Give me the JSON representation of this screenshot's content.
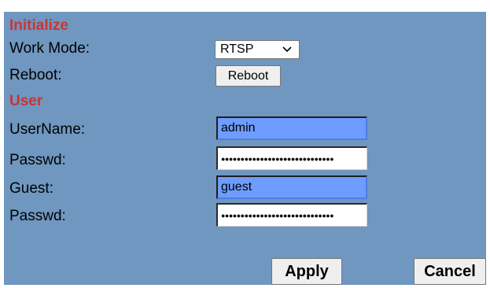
{
  "initialize": {
    "title": "Initialize",
    "work_mode_label": "Work Mode:",
    "work_mode_value": "RTSP",
    "reboot_label": "Reboot:",
    "reboot_button": "Reboot"
  },
  "user": {
    "title": "User",
    "username_label": "UserName:",
    "username_value": "admin",
    "passwd_label": "Passwd:",
    "passwd_mask": "●●●●●●●●●●●●●●●●●●●●●●●●●●●●●",
    "guest_label": "Guest:",
    "guest_value": "guest",
    "guest_passwd_label": "Passwd:",
    "guest_passwd_mask": "●●●●●●●●●●●●●●●●●●●●●●●●●●●●●"
  },
  "actions": {
    "apply": "Apply",
    "cancel": "Cancel"
  },
  "icons": {
    "select_arrow": "chevron-down-icon"
  },
  "colors": {
    "panel_bg": "#6f97c0",
    "section_title": "#cc3333",
    "input_highlight": "#6e9cff"
  }
}
